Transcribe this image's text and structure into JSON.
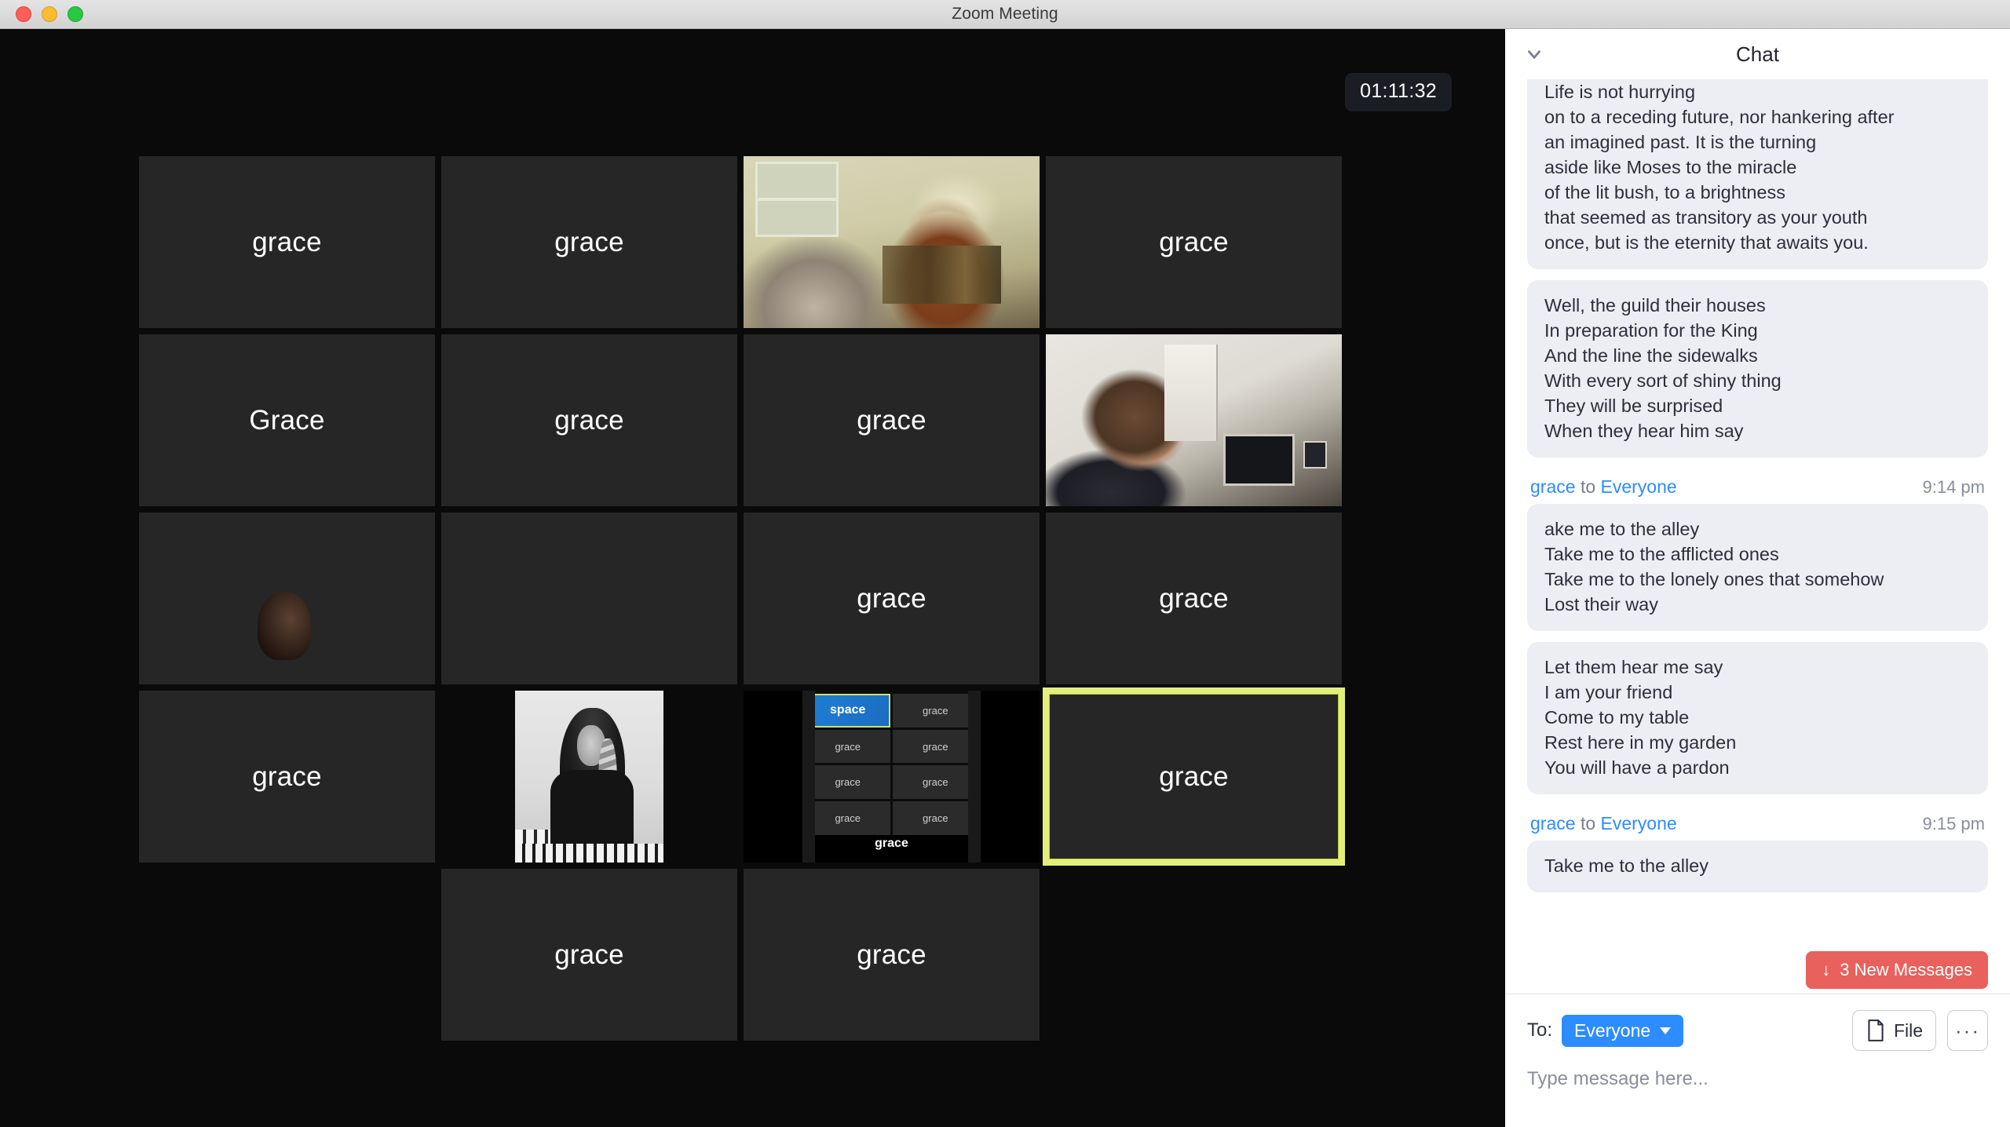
{
  "window": {
    "title": "Zoom Meeting",
    "traffic_lights": [
      "close",
      "minimize",
      "zoom"
    ]
  },
  "stage": {
    "timer": "01:11:32",
    "tiles": [
      {
        "label": "grace",
        "kind": "name"
      },
      {
        "label": "grace",
        "kind": "name"
      },
      {
        "label": "",
        "kind": "video-couple"
      },
      {
        "label": "grace",
        "kind": "name"
      },
      {
        "label": "Grace",
        "kind": "name"
      },
      {
        "label": "grace",
        "kind": "name"
      },
      {
        "label": "grace",
        "kind": "name"
      },
      {
        "label": "",
        "kind": "video-man"
      },
      {
        "label": "",
        "kind": "video-dark"
      },
      {
        "label": "",
        "kind": "name"
      },
      {
        "label": "grace",
        "kind": "name"
      },
      {
        "label": "grace",
        "kind": "name"
      },
      {
        "label": "grace",
        "kind": "name"
      },
      {
        "label": "",
        "kind": "video-bw"
      },
      {
        "label": "",
        "kind": "video-share"
      },
      {
        "label": "grace",
        "kind": "name",
        "active": true
      },
      {
        "label": "",
        "kind": "blank"
      },
      {
        "label": "grace",
        "kind": "name"
      },
      {
        "label": "grace",
        "kind": "name"
      },
      {
        "label": "",
        "kind": "blank"
      }
    ],
    "shared_screen": {
      "mini_tiles": [
        "space",
        "grace",
        "grace",
        "grace",
        "grace",
        "grace",
        "grace",
        "grace"
      ],
      "selected_index": 0,
      "footer_text": "grace"
    },
    "active_speaker_color": "#e3ef7c"
  },
  "chat": {
    "title": "Chat",
    "collapse_icon": "chevron-down-icon",
    "messages": [
      {
        "text": "Life is not hurrying\non to a receding future, nor hankering after\nan imagined past. It is the turning\naside like Moses to the miracle\nof the lit bush, to a brightness\nthat seemed as transitory as your youth\nonce, but is the eternity that awaits you."
      },
      {
        "text": "Well, the guild their houses\nIn preparation for the King\nAnd the line the sidewalks\nWith every sort of shiny thing\nThey will be surprised\nWhen they hear him say"
      },
      {
        "sender": "grace",
        "to_word": "to",
        "recipient": "Everyone",
        "time": "9:14 pm",
        "text": "ake me to the alley\nTake me to the afflicted ones\nTake me to the lonely ones that somehow\nLost their way"
      },
      {
        "text": "Let them hear me say\nI am your friend\nCome to my table\nRest here in my garden\nYou will have a pardon"
      },
      {
        "sender": "grace",
        "to_word": "to",
        "recipient": "Everyone",
        "time": "9:15 pm",
        "text": "Take me to the alley"
      }
    ],
    "new_messages_badge": {
      "arrow": "↓",
      "label": "3 New Messages",
      "color": "#e8615c"
    },
    "footer": {
      "to_label": "To:",
      "recipient": "Everyone",
      "file_button": "File",
      "more_button": "···",
      "input_placeholder": "Type message here..."
    }
  }
}
